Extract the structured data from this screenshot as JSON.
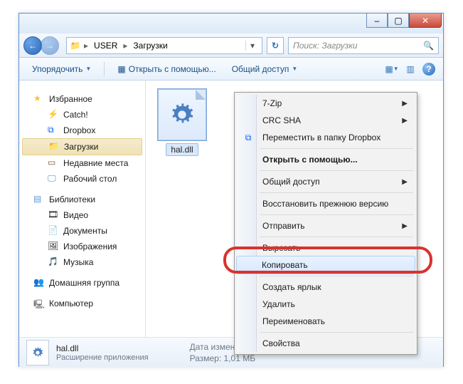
{
  "window_controls": {
    "min": "–",
    "max": "▢",
    "close": "✕"
  },
  "nav": {
    "back_icon": "←",
    "fwd_icon": "→",
    "breadcrumb": [
      "USER",
      "Загрузки"
    ],
    "refresh_icon": "↻",
    "search_placeholder": "Поиск: Загрузки"
  },
  "toolbar": {
    "organize": "Упорядочить",
    "open_with": "Открыть с помощью...",
    "share": "Общий доступ",
    "help_tooltip": "?"
  },
  "sidebar": {
    "favorites": {
      "label": "Избранное",
      "items": [
        "Catch!",
        "Dropbox",
        "Загрузки",
        "Недавние места",
        "Рабочий стол"
      ]
    },
    "libraries": {
      "label": "Библиотеки",
      "items": [
        "Видео",
        "Документы",
        "Изображения",
        "Музыка"
      ]
    },
    "homegroup": "Домашняя группа",
    "computer": "Компьютер"
  },
  "files": {
    "selected": {
      "name": "hal.dll"
    }
  },
  "statusbar": {
    "name": "hal.dll",
    "type": "Расширение приложения",
    "date_label": "Дата изменения:",
    "size_label": "Размер:",
    "size_value": "1,01 МБ"
  },
  "context_menu": {
    "items": [
      {
        "label": "7-Zip",
        "submenu": true
      },
      {
        "label": "CRC SHA",
        "submenu": true
      },
      {
        "label": "Переместить в папку Dropbox",
        "icon": "dropbox"
      },
      {
        "sep": true
      },
      {
        "label": "Открыть с помощью...",
        "bold": true
      },
      {
        "sep": true
      },
      {
        "label": "Общий доступ",
        "submenu": true
      },
      {
        "sep": true
      },
      {
        "label": "Восстановить прежнюю версию"
      },
      {
        "sep": true
      },
      {
        "label": "Отправить",
        "submenu": true
      },
      {
        "sep": true
      },
      {
        "label": "Вырезать"
      },
      {
        "label": "Копировать",
        "hover": true
      },
      {
        "sep": true
      },
      {
        "label": "Создать ярлык"
      },
      {
        "label": "Удалить"
      },
      {
        "label": "Переименовать"
      },
      {
        "sep": true
      },
      {
        "label": "Свойства"
      }
    ]
  }
}
